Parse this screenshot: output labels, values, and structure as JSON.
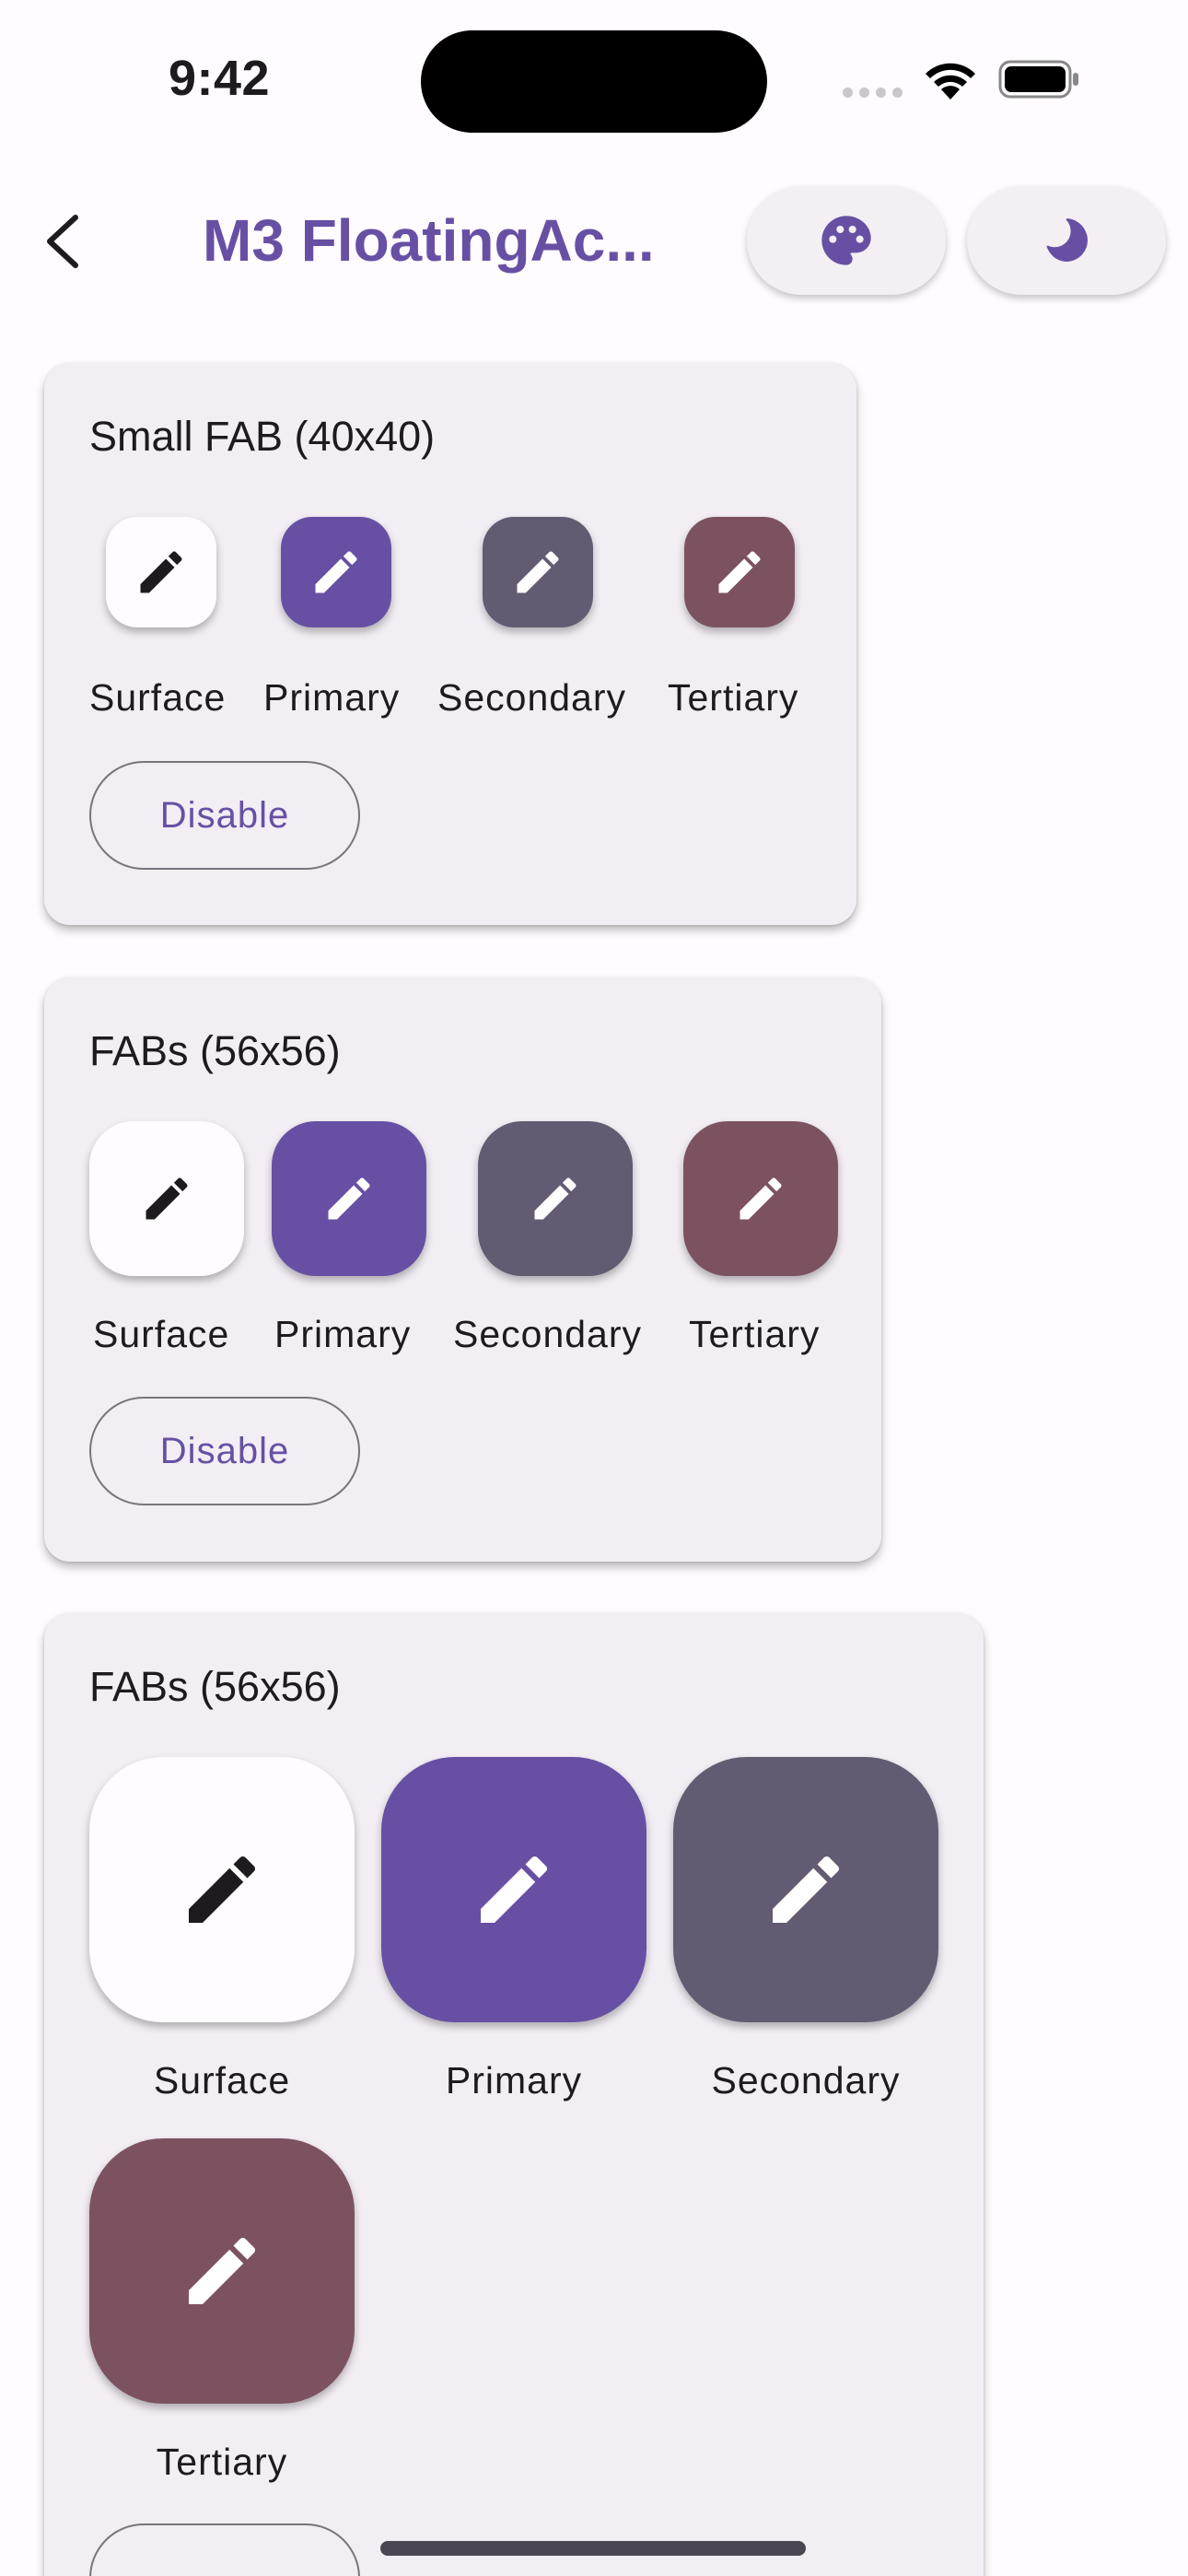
{
  "status_bar": {
    "time": "9:42"
  },
  "app_bar": {
    "title": "M3 FloatingAc..."
  },
  "colors": {
    "primary": "#6750A4",
    "secondary": "#625B71",
    "tertiary": "#7D5260",
    "surface": "#FFFBFE"
  },
  "icons": {
    "back": "chevron-left-icon",
    "palette": "palette-icon",
    "theme": "moon-icon",
    "fab": "pencil-icon"
  },
  "cards": [
    {
      "title": "Small FAB (40x40)",
      "fabs": [
        {
          "label": "Surface"
        },
        {
          "label": "Primary"
        },
        {
          "label": "Secondary"
        },
        {
          "label": "Tertiary"
        }
      ],
      "button": "Disable"
    },
    {
      "title": "FABs (56x56)",
      "fabs": [
        {
          "label": "Surface"
        },
        {
          "label": "Primary"
        },
        {
          "label": "Secondary"
        },
        {
          "label": "Tertiary"
        }
      ],
      "button": "Disable"
    },
    {
      "title": "FABs (56x56)",
      "fabs": [
        {
          "label": "Surface"
        },
        {
          "label": "Primary"
        },
        {
          "label": "Secondary"
        },
        {
          "label": "Tertiary"
        }
      ]
    }
  ]
}
